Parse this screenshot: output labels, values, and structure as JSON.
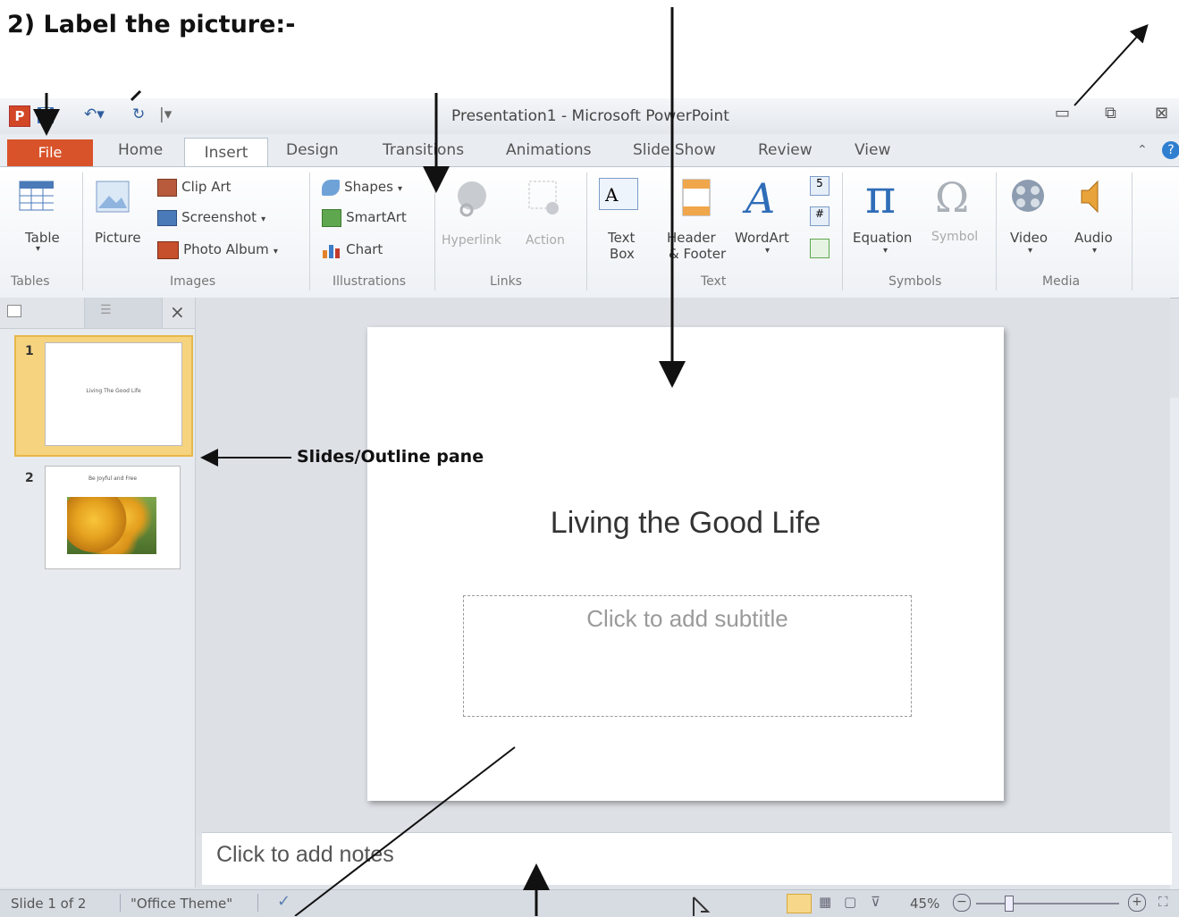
{
  "heading": "2) Label the picture:-",
  "window": {
    "title": "Presentation1 - Microsoft PowerPoint"
  },
  "tabs": {
    "file": "File",
    "home": "Home",
    "insert": "Insert",
    "design": "Design",
    "transitions": "Transitions",
    "animations": "Animations",
    "slideshow": "Slide Show",
    "review": "Review",
    "view": "View"
  },
  "ribbon": {
    "tables": {
      "group": "Tables",
      "table": "Table"
    },
    "images": {
      "group": "Images",
      "picture": "Picture",
      "clip_art": "Clip Art",
      "screenshot": "Screenshot",
      "photo_album": "Photo Album"
    },
    "illustrations": {
      "group": "Illustrations",
      "shapes": "Shapes",
      "smartart": "SmartArt",
      "chart": "Chart"
    },
    "links": {
      "group": "Links",
      "hyperlink": "Hyperlink",
      "action": "Action"
    },
    "text": {
      "group": "Text",
      "text_box_1": "Text",
      "text_box_2": "Box",
      "header_1": "Header",
      "header_2": "& Footer",
      "wordart": "WordArt"
    },
    "symbols": {
      "group": "Symbols",
      "equation": "Equation",
      "symbol": "Symbol",
      "pi": "π",
      "omega": "Ω"
    },
    "media": {
      "group": "Media",
      "video": "Video",
      "audio": "Audio"
    }
  },
  "slides_pane": {
    "slide1_num": "1",
    "slide2_num": "2",
    "slide1_caption": "Living The Good Life",
    "slide2_caption": "Be Joyful and Free"
  },
  "slide": {
    "title": "Living the Good Life",
    "subtitle_placeholder": "Click to add subtitle"
  },
  "notes": {
    "placeholder": "Click to add notes"
  },
  "status": {
    "slide_count": "Slide 1 of 2",
    "theme": "\"Office Theme\"",
    "zoom": "45%"
  },
  "annotations": {
    "slides_outline_pane": "Slides/Outline pane"
  }
}
